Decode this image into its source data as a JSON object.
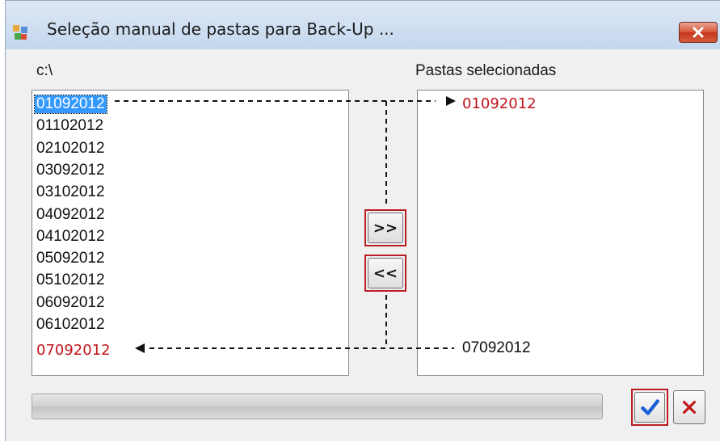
{
  "window": {
    "title": "Seleção manual de pastas para Back-Up ..."
  },
  "left_panel": {
    "label": "c:\\",
    "items": [
      "01092012",
      "01102012",
      "02102012",
      "03092012",
      "03102012",
      "04092012",
      "04102012",
      "05092012",
      "05102012",
      "06092012",
      "06102012"
    ],
    "selected_item": "01092012",
    "returned_item": "07092012"
  },
  "right_panel": {
    "label": "Pastas selecionadas",
    "added_item": "01092012",
    "existing_item": "07092012"
  },
  "buttons": {
    "add_label": ">>",
    "remove_label": "<<"
  },
  "progress": {
    "value": 0
  },
  "colors": {
    "highlight": "#b91d23",
    "selection": "#3399ff",
    "moved_text": "#c0141b",
    "confirm_check": "#1a5fd6",
    "cancel_x": "#c21a1a"
  },
  "icons": {
    "app": "app-window-icon",
    "close": "close-icon",
    "confirm": "checkmark-icon",
    "cancel": "x-icon"
  }
}
